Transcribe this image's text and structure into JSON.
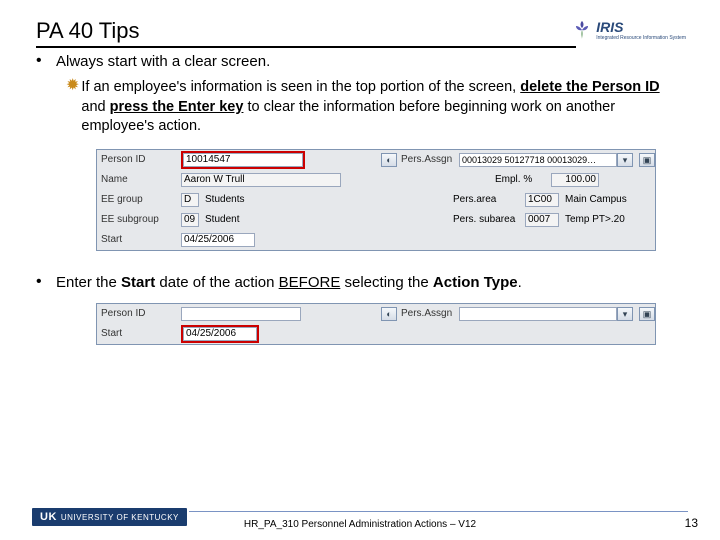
{
  "header": {
    "title": "PA 40 Tips",
    "logo_text": "IRIS",
    "logo_sub": "Integrated Resource Information System"
  },
  "bullets": {
    "b1": "Always start with a clear screen.",
    "sub1_pre": "If an employee's information is seen in the top portion of the screen, ",
    "sub1_u1": "delete the Person ID",
    "sub1_mid": " and ",
    "sub1_u2": "press the Enter key",
    "sub1_post": " to clear the information before beginning work on another employee's action.",
    "b2_pre": "Enter the ",
    "b2_b1": "Start",
    "b2_mid1": " date of the action ",
    "b2_u1": "BEFORE",
    "b2_mid2": " selecting the ",
    "b2_b2": "Action Type"
  },
  "form1": {
    "labels": {
      "person_id": "Person ID",
      "name": "Name",
      "ee_group": "EE group",
      "ee_subgroup": "EE subgroup",
      "start": "Start",
      "pers_assgn": "Pers.Assgn",
      "empl_pct": "Empl. %",
      "pers_area": "Pers.area",
      "pers_subarea": "Pers. subarea"
    },
    "values": {
      "person_id": "10014547",
      "name": "Aaron W Trull",
      "ee_group_code": "D",
      "ee_group_text": "Students",
      "ee_subgroup_code": "09",
      "ee_subgroup_text": "Student",
      "start": "04/25/2006",
      "pers_assgn": "00013029 50127718 00013029…",
      "empl_pct": "100.00",
      "pers_area_code": "1C00",
      "pers_area_text": "Main Campus",
      "pers_subarea_code": "0007",
      "pers_subarea_text": "Temp PT>.20"
    }
  },
  "form2": {
    "labels": {
      "person_id": "Person ID",
      "start": "Start",
      "pers_assgn": "Pers.Assgn"
    },
    "values": {
      "start": "04/25/2006"
    }
  },
  "footer": {
    "uk_prefix": "UK",
    "uk_text": "UNIVERSITY OF KENTUCKY",
    "center": "HR_PA_310 Personnel Administration Actions – V12",
    "page": "13"
  }
}
